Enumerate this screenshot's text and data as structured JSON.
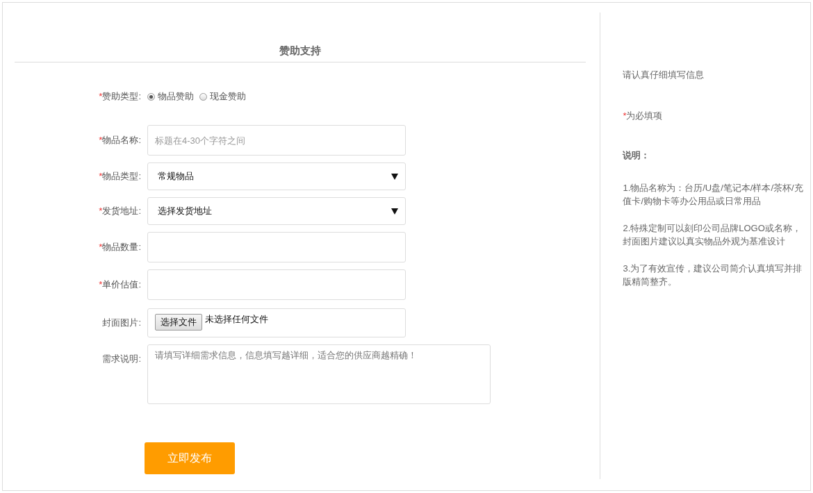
{
  "title": "赞助支持",
  "fields": [
    {
      "kind": "radio",
      "required_mark": "*",
      "label": "赞助类型:",
      "options": [
        {
          "label": "物品赞助",
          "selected": true
        },
        {
          "label": "现金赞助",
          "selected": false
        }
      ]
    },
    {
      "kind": "text",
      "required_mark": "*",
      "label": "物品名称:",
      "placeholder": "标题在4-30个字符之间"
    },
    {
      "kind": "select",
      "required_mark": "*",
      "label": "物品类型:",
      "value": "常规物品"
    },
    {
      "kind": "select",
      "required_mark": "*",
      "label": "发货地址:",
      "value": "选择发货地址"
    },
    {
      "kind": "text",
      "required_mark": "*",
      "label": "物品数量:"
    },
    {
      "kind": "text",
      "required_mark": "*",
      "label": "单价估值:"
    },
    {
      "kind": "file",
      "label": "封面图片:",
      "button": "选择文件",
      "status": "未选择任何文件"
    },
    {
      "kind": "textarea",
      "label": "需求说明:",
      "placeholder": "请填写详细需求信息，信息填写越详细，适合您的供应商越精确！"
    }
  ],
  "submit": "立即发布",
  "sidebar": {
    "intro": "请认真仔细填写信息",
    "required_note": {
      "mark": "*",
      "text": "为必填项"
    },
    "notes_title": "说明：",
    "notes": [
      "1.物品名称为：台历/U盘/笔记本/样本/茶杯/充值卡/购物卡等办公用品或日常用品",
      "2.特殊定制可以刻印公司品牌LOGO或名称，封面图片建议以真实物品外观为基准设计",
      "3.为了有效宣传，建议公司简介认真填写并排版精简整齐。"
    ]
  }
}
